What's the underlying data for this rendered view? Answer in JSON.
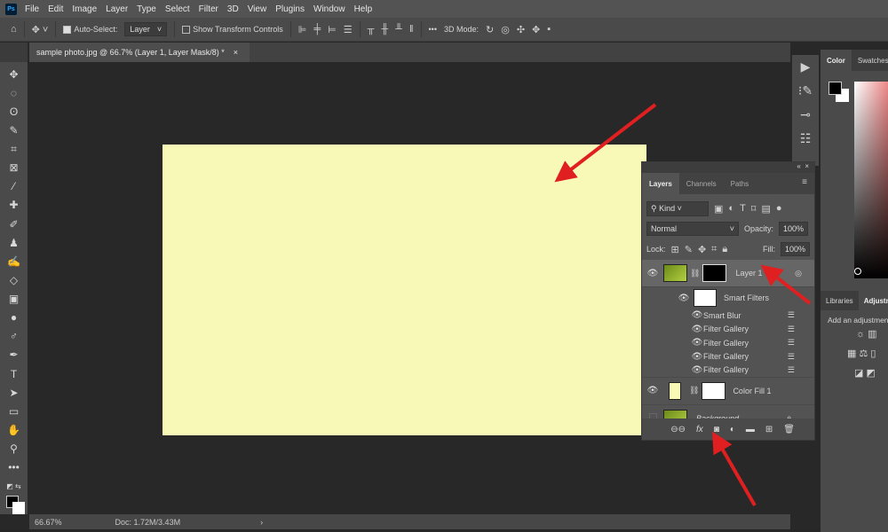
{
  "menu": {
    "logo": "Ps",
    "items": [
      "File",
      "Edit",
      "Image",
      "Layer",
      "Type",
      "Select",
      "Filter",
      "3D",
      "View",
      "Plugins",
      "Window",
      "Help"
    ]
  },
  "options": {
    "auto_select_label": "Auto-Select:",
    "auto_select_checked": true,
    "auto_select_target": "Layer",
    "show_transform_label": "Show Transform Controls",
    "show_transform_checked": false,
    "more": "•••",
    "mode_3d_label": "3D Mode:"
  },
  "document_tab": {
    "title": "sample photo.jpg @ 66.7% (Layer 1, Layer Mask/8) *",
    "close": "×"
  },
  "canvas": {
    "fill_color": "#f9f9b7"
  },
  "status": {
    "zoom": "66.67%",
    "doc": "Doc: 1.72M/3.43M",
    "arrow": "›"
  },
  "color_panel": {
    "tabs": [
      "Color",
      "Swatches"
    ],
    "foreground": "#000000",
    "background": "#ffffff"
  },
  "adjust_panel": {
    "tabs": [
      "Libraries",
      "Adjustments"
    ],
    "hint": "Add an adjustment"
  },
  "layers_panel": {
    "tabs": [
      "Layers",
      "Channels",
      "Paths"
    ],
    "filter_kind": "Kind",
    "blend_mode": "Normal",
    "opacity_label": "Opacity:",
    "opacity": "100%",
    "lock_label": "Lock:",
    "fill_label": "Fill:",
    "fill": "100%",
    "layers": [
      {
        "name": "Layer 1",
        "visible": true,
        "selected": true
      },
      {
        "name": "Smart Filters",
        "visible": true
      },
      {
        "name": "Color Fill 1",
        "visible": true
      },
      {
        "name": "Background",
        "visible": false,
        "locked": true
      }
    ],
    "filters": [
      "Smart Blur",
      "Filter Gallery",
      "Filter Gallery",
      "Filter Gallery",
      "Filter Gallery"
    ]
  },
  "annotation_color": "#e02020"
}
